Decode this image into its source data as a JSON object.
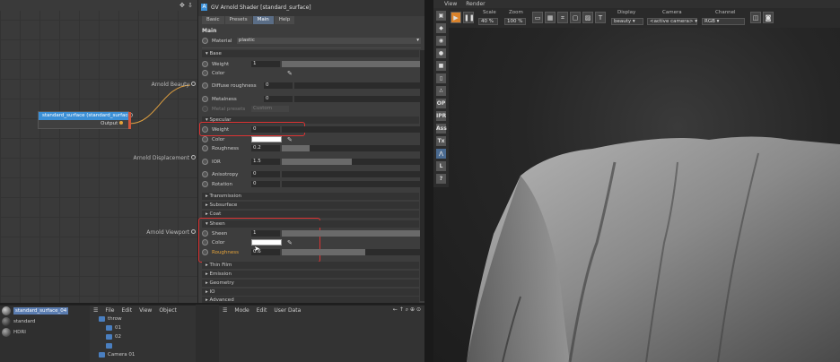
{
  "node_editor": {
    "node_title": "standard_surface (standard_surface)",
    "node_output": "Output",
    "ports": [
      "Arnold Beauty",
      "Arnold Displacement",
      "Arnold Viewport"
    ]
  },
  "attributes": {
    "title": "GV Arnold Shader [standard_surface]",
    "tabs": [
      "Basic",
      "Presets",
      "Main",
      "Help"
    ],
    "active_tab": "Main",
    "section": "Main",
    "material_label": "Material",
    "material_value": "plastic",
    "groups": {
      "base": "Base",
      "specular": "Specular",
      "transmission": "Transmission",
      "subsurface": "Subsurface",
      "coat": "Coat",
      "sheen": "Sheen",
      "thin_film": "Thin Film",
      "emission": "Emission",
      "geometry": "Geometry",
      "io": "IO",
      "advanced": "Advanced"
    },
    "base_rows": [
      {
        "label": "Weight",
        "value": "1",
        "fill": 1.0
      },
      {
        "label": "Color",
        "value": "",
        "fill": 0
      },
      {
        "label": "Diffuse roughness",
        "value": "0",
        "fill": 0
      },
      {
        "label": "Metalness",
        "value": "0",
        "fill": 0
      }
    ],
    "metal_presets_label": "Metal presets",
    "metal_presets_value": "Custom",
    "specular_rows": [
      {
        "label": "Weight",
        "value": "0",
        "fill": 0
      },
      {
        "label": "Color",
        "value": "",
        "fill": 0
      },
      {
        "label": "Roughness",
        "value": "0.2",
        "fill": 0.2
      },
      {
        "label": "IOR",
        "value": "1.5",
        "fill": 0.5
      },
      {
        "label": "Anisotropy",
        "value": "0",
        "fill": 0
      },
      {
        "label": "Rotation",
        "value": "0",
        "fill": 0
      }
    ],
    "sheen_rows": [
      {
        "label": "Sheen",
        "value": "1",
        "fill": 1.0
      },
      {
        "label": "Color",
        "value": "",
        "fill": 0
      },
      {
        "label": "Roughness",
        "value": "0.6",
        "fill": 0.6
      }
    ]
  },
  "viewport": {
    "menu": [
      "View",
      "Render"
    ],
    "scale_label": "Scale",
    "scale_value": "40 %",
    "zoom_label": "Zoom",
    "zoom_value": "100 %",
    "display_label": "Display",
    "display_value": "beauty",
    "camera_label": "Camera",
    "camera_value": "<active camera>",
    "channel_label": "Channel",
    "channel_value": "RGB",
    "side_tools": [
      "OP",
      "IPR",
      "Ass",
      "Tx",
      "L",
      "?"
    ]
  },
  "materials": [
    "standard_surface_04",
    "standard",
    "HDRI"
  ],
  "object_manager": {
    "menu": [
      "File",
      "Edit",
      "View",
      "Object"
    ],
    "objects": [
      "throw",
      "01",
      "02",
      "",
      "Camera 01"
    ]
  },
  "layer_manager": {
    "menu": [
      "Mode",
      "Edit",
      "User Data"
    ]
  }
}
